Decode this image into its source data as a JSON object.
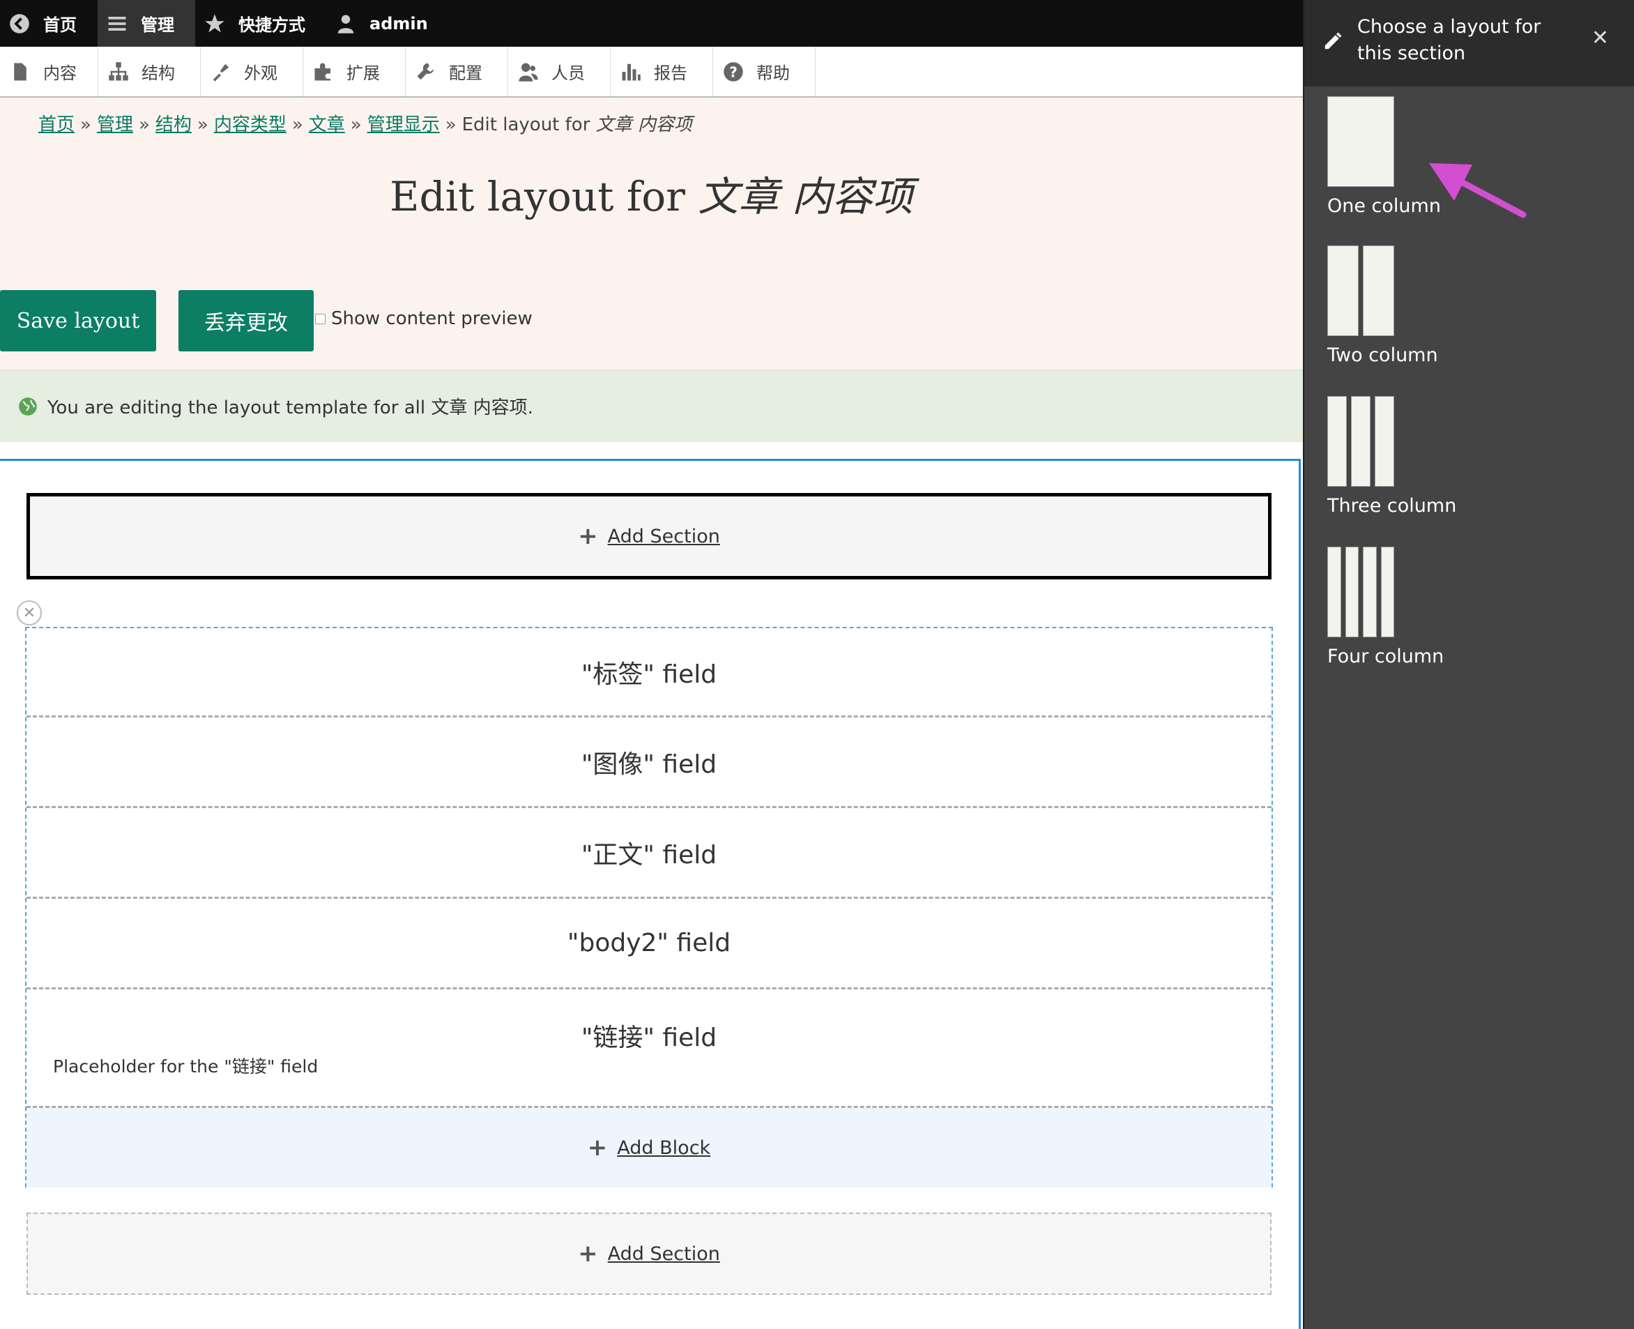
{
  "toolbar": {
    "back_label": "首页",
    "manage_label": "管理",
    "shortcuts_label": "快捷方式",
    "user_label": "admin"
  },
  "tray": {
    "items": [
      {
        "label": "内容",
        "icon": "file-icon"
      },
      {
        "label": "结构",
        "icon": "sitemap-icon"
      },
      {
        "label": "外观",
        "icon": "brush-icon"
      },
      {
        "label": "扩展",
        "icon": "puzzle-icon"
      },
      {
        "label": "配置",
        "icon": "wrench-icon"
      },
      {
        "label": "人员",
        "icon": "people-icon"
      },
      {
        "label": "报告",
        "icon": "bar-chart-icon"
      },
      {
        "label": "帮助",
        "icon": "help-icon"
      }
    ]
  },
  "breadcrumb": {
    "links": [
      "首页",
      "管理",
      "结构",
      "内容类型",
      "文章",
      "管理显示"
    ],
    "current_prefix": "Edit layout for",
    "current_em": "文章 内容项",
    "separator": "»"
  },
  "page": {
    "title_prefix": "Edit layout for",
    "title_em": "文章 内容项",
    "save_label": "Save layout",
    "discard_label": "丢弃更改",
    "preview_label": "Show content preview",
    "status_message": "You are editing the layout template for all 文章 内容项."
  },
  "builder": {
    "add_section_label": "Add Section",
    "add_block_label": "Add Block",
    "remove_symbol": "✕",
    "blocks": [
      {
        "label": "\"标签\" field"
      },
      {
        "label": "\"图像\" field"
      },
      {
        "label": "\"正文\" field"
      },
      {
        "label": "\"body2\" field"
      },
      {
        "label": "\"链接\" field",
        "placeholder": "Placeholder for the \"链接\" field"
      }
    ]
  },
  "sidebar": {
    "title": "Choose a layout for this section",
    "close_symbol": "✕",
    "options": [
      {
        "label": "One column"
      },
      {
        "label": "Two column"
      },
      {
        "label": "Three column"
      },
      {
        "label": "Four column"
      }
    ]
  },
  "colors": {
    "accent": "#0b7e63",
    "arrow": "#d24fd2",
    "builder_border": "#2a8ad4"
  }
}
